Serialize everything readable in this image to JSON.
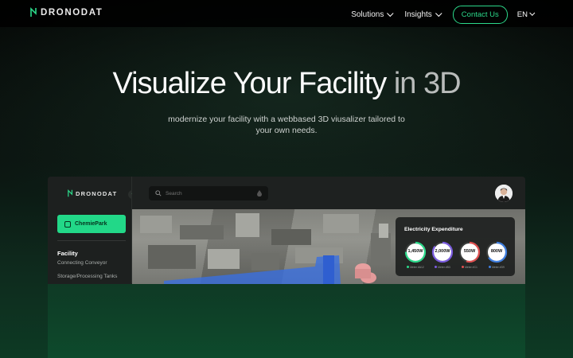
{
  "nav": {
    "brand": "DRONODAT",
    "links": [
      {
        "label": "Solutions"
      },
      {
        "label": "Insights"
      }
    ],
    "contact_label": "Contact Us",
    "language": "EN"
  },
  "hero": {
    "title_main": "Visualize Your Facility",
    "title_dim": " in 3D",
    "subtitle": "modernize your facility with a webbased 3D viusalizer tailored to your own needs."
  },
  "app": {
    "brand": "DRONODAT",
    "project_button": "ChemiePark",
    "section_title": "Facility",
    "section_items": [
      "Connecting Conveyor",
      "Storage/Processing Tanks"
    ],
    "search_placeholder": "Search",
    "electricity": {
      "title": "Electricity Expenditure",
      "gauges": [
        {
          "value": "1,450W",
          "label": "Meter #A12",
          "color": "#2bd98a",
          "fill": 0.75
        },
        {
          "value": "2,000W",
          "label": "Meter #B3",
          "color": "#7b5ce0",
          "fill": 0.85
        },
        {
          "value": "550W",
          "label": "Meter #C1",
          "color": "#e05050",
          "fill": 0.55
        },
        {
          "value": "800W",
          "label": "Meter #D9",
          "color": "#3f7fe0",
          "fill": 0.65
        }
      ]
    }
  },
  "colors": {
    "accent": "#2bd98a",
    "button_fill": "#22d888"
  }
}
